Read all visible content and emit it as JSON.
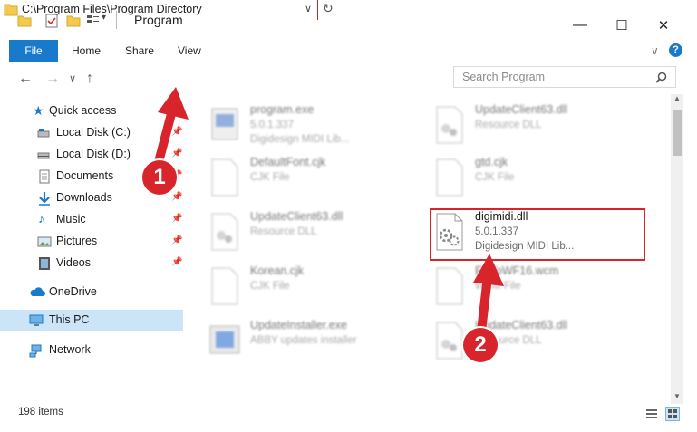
{
  "window": {
    "title": "Program",
    "controls": {
      "minimize": "—",
      "maximize": "☐",
      "close": "✕"
    }
  },
  "ribbon": {
    "tabs": [
      "File",
      "Home",
      "Share",
      "View"
    ],
    "help": "?",
    "collapse": "∨"
  },
  "nav": {
    "back": "←",
    "forward": "→",
    "recent": "∨",
    "up": "↑",
    "address": "C:\\Program Files\\Program Directory",
    "address_dropdown": "∨",
    "refresh": "↻",
    "search_placeholder": "Search Program",
    "search_icon": "search-icon"
  },
  "sidebar": {
    "items": [
      {
        "label": "Quick access",
        "icon": "star-icon"
      },
      {
        "label": "Local Disk (C:)",
        "icon": "drive-icon",
        "pinned": true
      },
      {
        "label": "Local Disk (D:)",
        "icon": "drive-icon",
        "pinned": true
      },
      {
        "label": "Documents",
        "icon": "documents-icon",
        "pinned": true
      },
      {
        "label": "Downloads",
        "icon": "download-icon",
        "pinned": true
      },
      {
        "label": "Music",
        "icon": "music-icon",
        "pinned": true
      },
      {
        "label": "Pictures",
        "icon": "pictures-icon",
        "pinned": true
      },
      {
        "label": "Videos",
        "icon": "videos-icon",
        "pinned": true
      },
      {
        "label": "OneDrive",
        "icon": "cloud-icon"
      },
      {
        "label": "This PC",
        "icon": "computer-icon",
        "selected": true
      },
      {
        "label": "Network",
        "icon": "network-icon"
      }
    ]
  },
  "files": [
    {
      "name": "program.exe",
      "line1": "5.0.1.337",
      "line2": "Digidesign MIDI Lib...",
      "icon": "exe-icon"
    },
    {
      "name": "UpdateClient63.dll",
      "line1": "Resource DLL",
      "line2": "",
      "icon": "dll-icon"
    },
    {
      "name": "DefaultFont.cjk",
      "line1": "CJK File",
      "line2": "",
      "icon": "file-icon"
    },
    {
      "name": "gtd.cjk",
      "line1": "CJK File",
      "line2": "",
      "icon": "file-icon"
    },
    {
      "name": "UpdateClient63.dll",
      "line1": "Resource DLL",
      "line2": "",
      "icon": "dll-icon"
    },
    {
      "name": "digimidi.dll",
      "line1": "5.0.1.337",
      "line2": "Digidesign MIDI Lib...",
      "icon": "dll-icon"
    },
    {
      "name": "Korean.cjk",
      "line1": "CJK File",
      "line2": "",
      "icon": "file-icon"
    },
    {
      "name": "ErrToWF16.wcm",
      "line1": "WCM File",
      "line2": "",
      "icon": "file-icon"
    },
    {
      "name": "UpdateInstaller.exe",
      "line1": "ABBY updates installer",
      "line2": "",
      "icon": "installer-icon"
    },
    {
      "name": "UpdateClient63.dll",
      "line1": "Resource DLL",
      "line2": "",
      "icon": "dll-icon"
    }
  ],
  "annotations": [
    "1",
    "2"
  ],
  "status": {
    "count": "198 items"
  },
  "colors": {
    "accent": "#1979ca",
    "annotation_red": "#d8242b",
    "selected_bg": "#cce4f7"
  }
}
